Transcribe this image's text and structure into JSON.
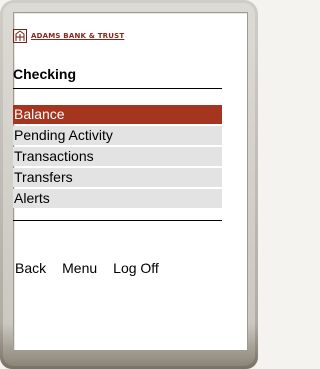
{
  "brand": {
    "name": "ADAMS BANK & TRUST",
    "logo_icon": "building-icon",
    "color": "#8b2519"
  },
  "page": {
    "title": "Checking"
  },
  "menu": {
    "items": [
      {
        "label": "Balance",
        "selected": true
      },
      {
        "label": "Pending Activity",
        "selected": false
      },
      {
        "label": "Transactions",
        "selected": false
      },
      {
        "label": "Transfers",
        "selected": false
      },
      {
        "label": "Alerts",
        "selected": false
      }
    ],
    "selected_color": "#a5351f",
    "item_background": "#e3e3e3"
  },
  "softkeys": {
    "back": "Back",
    "menu": "Menu",
    "logoff": "Log Off"
  }
}
